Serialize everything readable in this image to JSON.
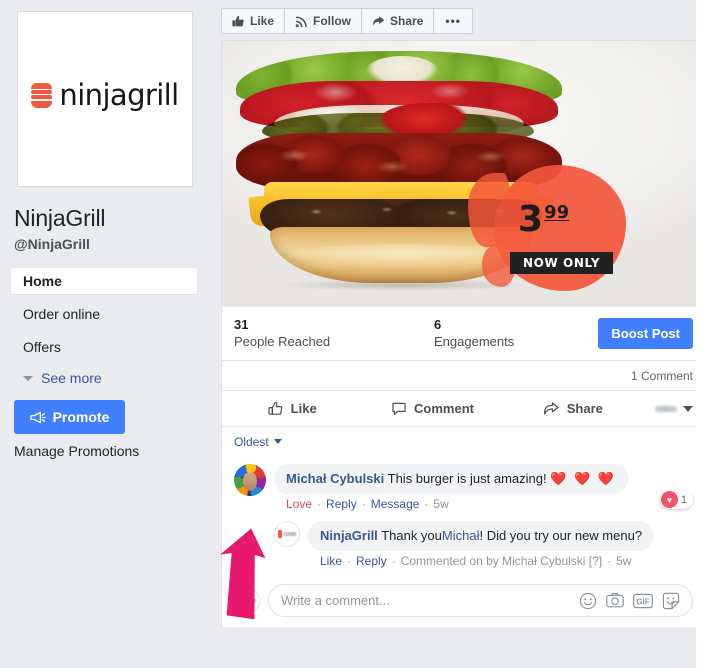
{
  "sidebar": {
    "profile_photo": {
      "logo_text": "ninjagrill",
      "camera_icon": "camera-icon"
    },
    "page_name": "NinjaGrill",
    "page_handle": "@NinjaGrill",
    "nav_items": [
      {
        "label": "Home",
        "active": true
      },
      {
        "label": "Order online",
        "active": false
      },
      {
        "label": "Offers",
        "active": false
      }
    ],
    "see_more": "See more",
    "promote_button": "Promote",
    "promote_icon": "megaphone-icon",
    "manage_promotions": "Manage Promotions"
  },
  "toolbar": {
    "like": "Like",
    "like_icon": "thumbs-up-filled-icon",
    "follow": "Follow",
    "follow_icon": "rss-icon",
    "share": "Share",
    "share_icon": "share-arrow-icon",
    "more": "•••"
  },
  "post": {
    "photo": {
      "alt": "bacon cheeseburger promotional photo",
      "price_integer": "3",
      "price_decimal": "99",
      "badge_label": "NOW ONLY"
    },
    "insights": [
      {
        "value": "31",
        "label": "People Reached"
      },
      {
        "value": "6",
        "label": "Engagements"
      }
    ],
    "boost_button": "Boost Post",
    "comment_count": "1 Comment",
    "actions": [
      {
        "label": "Like",
        "icon": "thumbs-up-outline-icon"
      },
      {
        "label": "Comment",
        "icon": "speech-bubble-icon"
      },
      {
        "label": "Share",
        "icon": "share-arrow-outline-icon"
      }
    ],
    "sort": {
      "label": "Oldest",
      "caret_icon": "chevron-down-icon"
    }
  },
  "comments": [
    {
      "author": "Michał Cybulski",
      "text": "This burger is just amazing!",
      "hearts": "❤️ ❤️ ❤️",
      "meta": {
        "reaction": "Love",
        "reply": "Reply",
        "message": "Message",
        "time": "5w"
      },
      "reaction_pill": {
        "icon": "heart-reaction-icon",
        "count": "1"
      }
    },
    {
      "author": "NinjaGrill",
      "text_before": "Thank you",
      "mention": "Michał",
      "text_after": "! Did you try our new menu?",
      "meta": {
        "like": "Like",
        "reply": "Reply",
        "commented_by": "Commented on by Michał Cybulski [?]",
        "time": "5w"
      }
    }
  ],
  "composer": {
    "placeholder": "Write a comment...",
    "icons": [
      "emoji-icon",
      "camera-icon",
      "gif-icon",
      "sticker-icon"
    ]
  },
  "colors": {
    "facebook_blue": "#4080ff",
    "link_blue": "#365899",
    "brand_orange": "#ef5a3c",
    "splash_orange": "#f4563a",
    "love_red": "#e8465f",
    "annotation_pink": "#e8196e"
  }
}
